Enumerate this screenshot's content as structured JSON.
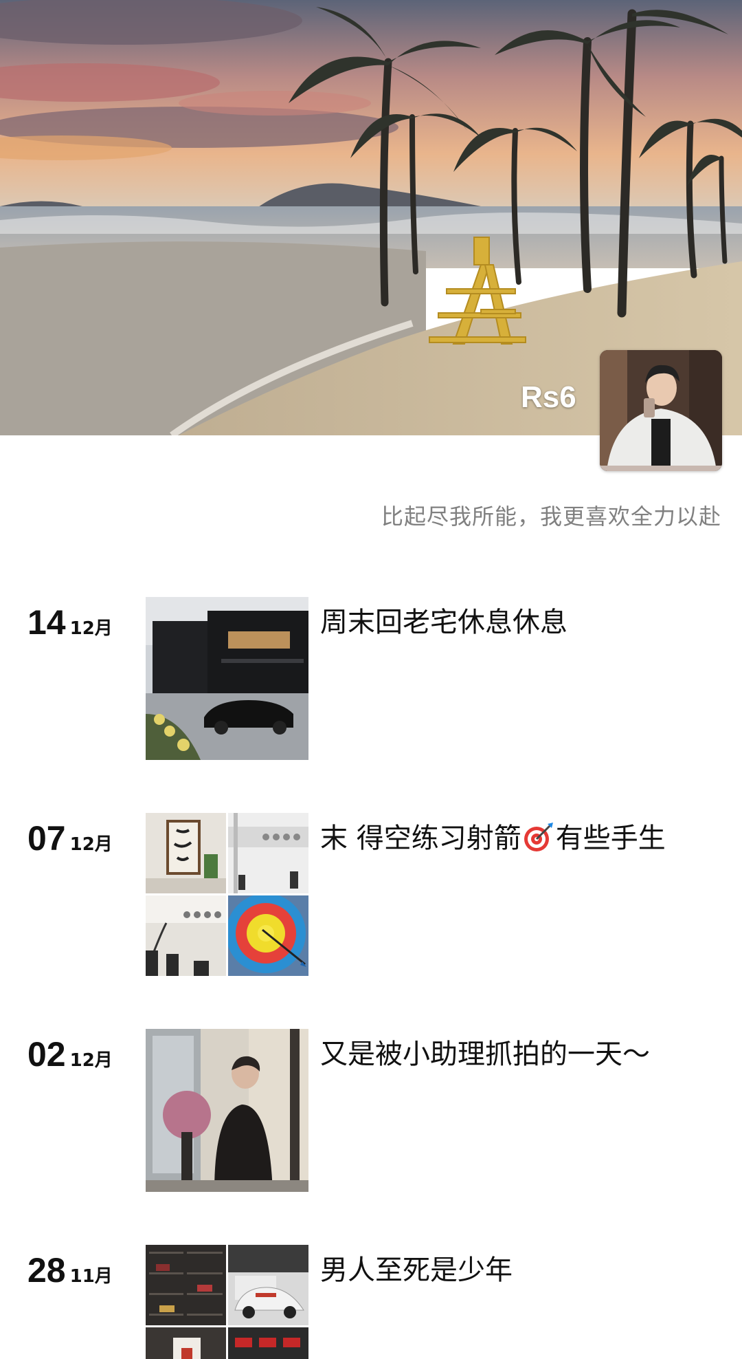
{
  "profile": {
    "nickname": "Rs6",
    "signature": "比起尽我所能，我更喜欢全力以赴"
  },
  "posts": [
    {
      "day": "14",
      "month": "12月",
      "text": "周末回老宅休息休息",
      "photo_count": 1
    },
    {
      "day": "07",
      "month": "12月",
      "text_before": "末 得空练习射箭",
      "emoji": "target-emoji",
      "text_after": "有些手生",
      "photo_count": 4
    },
    {
      "day": "02",
      "month": "12月",
      "text": "又是被小助理抓拍的一天～",
      "photo_count": 1
    },
    {
      "day": "28",
      "month": "11月",
      "text": "男人至死是少年",
      "photo_count": 4
    }
  ],
  "colors": {
    "sand": "#c9b89c",
    "sea": "#b7b2ad",
    "sky_warm": "#e7a37a",
    "text": "#111111",
    "signature": "#808080"
  }
}
